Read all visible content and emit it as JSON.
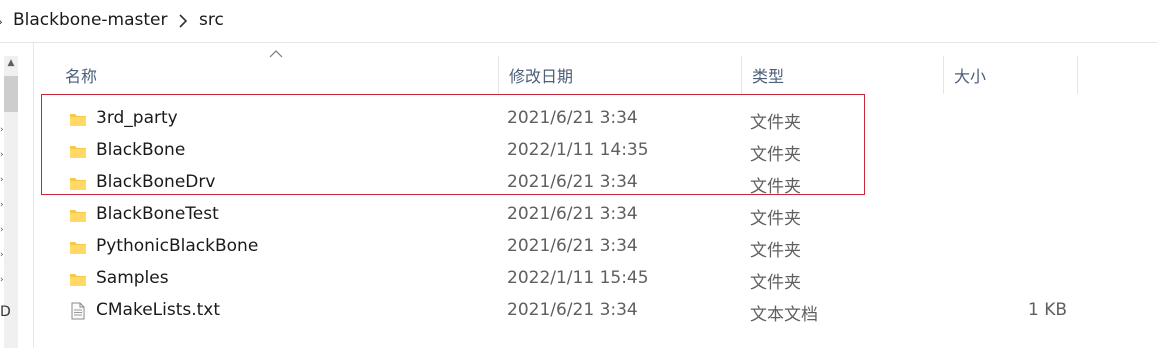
{
  "breadcrumb": {
    "items": [
      "Blackbone-master",
      "src"
    ]
  },
  "columns": {
    "name": "名称",
    "date": "修改日期",
    "type": "类型",
    "size": "大小"
  },
  "files": [
    {
      "name": "3rd_party",
      "date": "2021/6/21 3:34",
      "type": "文件夹",
      "size": "",
      "icon": "folder-icon"
    },
    {
      "name": "BlackBone",
      "date": "2022/1/11 14:35",
      "type": "文件夹",
      "size": "",
      "icon": "folder-icon"
    },
    {
      "name": "BlackBoneDrv",
      "date": "2021/6/21 3:34",
      "type": "文件夹",
      "size": "",
      "icon": "folder-icon"
    },
    {
      "name": "BlackBoneTest",
      "date": "2021/6/21 3:34",
      "type": "文件夹",
      "size": "",
      "icon": "folder-icon"
    },
    {
      "name": "PythonicBlackBone",
      "date": "2021/6/21 3:34",
      "type": "文件夹",
      "size": "",
      "icon": "folder-icon"
    },
    {
      "name": "Samples",
      "date": "2022/1/11 15:45",
      "type": "文件夹",
      "size": "",
      "icon": "folder-icon"
    },
    {
      "name": "CMakeLists.txt",
      "date": "2021/6/21 3:34",
      "type": "文本文档",
      "size": "1 KB",
      "icon": "text-file-icon"
    }
  ],
  "nav": {
    "partial_label": "D"
  },
  "colors": {
    "highlight_border": "#c8263a",
    "folder_yellow": "#f5c84c",
    "header_text": "#4c607a"
  }
}
